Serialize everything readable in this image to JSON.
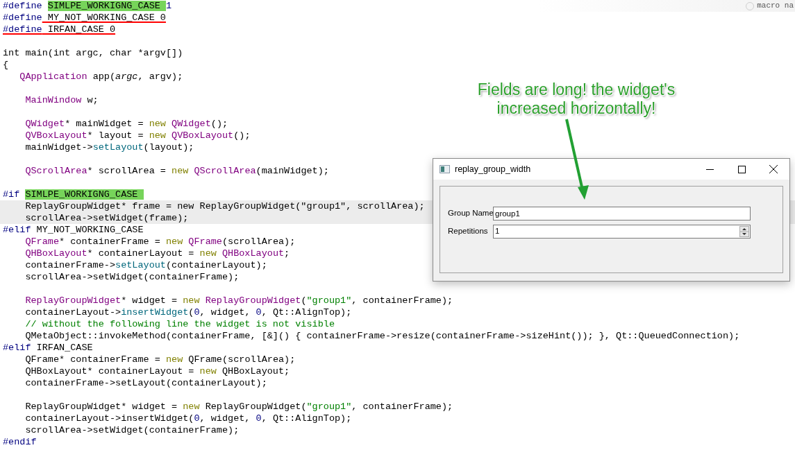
{
  "editor": {
    "lines": [
      {
        "current": false,
        "hint": "macro na",
        "segments": [
          {
            "text": "#define ",
            "kind": "directive"
          },
          {
            "text": "SIMLPE_WORKIGNG_CASE ",
            "kind": "highlight"
          },
          {
            "text": "1",
            "kind": "number"
          }
        ]
      },
      {
        "current": false,
        "segments": [
          {
            "text": "#define",
            "kind": "directive"
          },
          {
            "text": " MY_NOT_WORKING_CASE 0",
            "kind": "error"
          }
        ]
      },
      {
        "current": false,
        "segments": [
          {
            "text": "#define",
            "kind": "directive_error"
          },
          {
            "text": " IRFAN_CASE 0",
            "kind": "error"
          }
        ]
      },
      {
        "current": false
      },
      {
        "current": false,
        "segments": [
          {
            "text": "int main(int argc, char *argv[])",
            "kind": "plain"
          }
        ]
      },
      {
        "current": false,
        "segments": [
          {
            "text": "{",
            "kind": "plain"
          }
        ]
      },
      {
        "current": false,
        "segments": [
          {
            "text": "   QApplication",
            "kind": "type"
          },
          {
            "text": " app(",
            "kind": "plain"
          },
          {
            "text": "argc",
            "kind": "italic"
          },
          {
            "text": ", argv);",
            "kind": "plain"
          }
        ]
      },
      {
        "current": false
      },
      {
        "current": false,
        "segments": [
          {
            "text": "    MainWindow",
            "kind": "type"
          },
          {
            "text": " w;",
            "kind": "plain"
          }
        ]
      },
      {
        "current": false
      },
      {
        "current": false,
        "segments": [
          {
            "text": "    QWidget",
            "kind": "type"
          },
          {
            "text": "* mainWidget = ",
            "kind": "plain"
          },
          {
            "text": "new ",
            "kind": "keyword"
          },
          {
            "text": "QWidget",
            "kind": "type"
          },
          {
            "text": "();",
            "kind": "plain"
          }
        ]
      },
      {
        "current": false,
        "segments": [
          {
            "text": "    QVBoxLayout",
            "kind": "type"
          },
          {
            "text": "* layout = ",
            "kind": "plain"
          },
          {
            "text": "new ",
            "kind": "keyword"
          },
          {
            "text": "QVBoxLayout",
            "kind": "type"
          },
          {
            "text": "();",
            "kind": "plain"
          }
        ]
      },
      {
        "current": false,
        "segments": [
          {
            "text": "    mainWidget->",
            "kind": "plain"
          },
          {
            "text": "setLayout",
            "kind": "function"
          },
          {
            "text": "(layout);",
            "kind": "plain"
          }
        ]
      },
      {
        "current": false
      },
      {
        "current": false,
        "segments": [
          {
            "text": "    QScrollArea",
            "kind": "type"
          },
          {
            "text": "* scrollArea = ",
            "kind": "plain"
          },
          {
            "text": "new ",
            "kind": "keyword"
          },
          {
            "text": "QScrollArea",
            "kind": "type"
          },
          {
            "text": "(mainWidget);",
            "kind": "plain"
          }
        ]
      },
      {
        "current": false
      },
      {
        "current": false,
        "segments": [
          {
            "text": "#if ",
            "kind": "directive"
          },
          {
            "text": "SIMLPE_WORKIGNG_CASE ",
            "kind": "highlight"
          }
        ]
      },
      {
        "current": true,
        "segments": [
          {
            "text": "    ReplayGroupWidget* frame = new ReplayGroupWidget(\"group1\", scrollArea);",
            "kind": "plain"
          }
        ]
      },
      {
        "current": true,
        "segments": [
          {
            "text": "    scrollArea->setWidget(frame);",
            "kind": "plain"
          }
        ]
      },
      {
        "current": false,
        "segments": [
          {
            "text": "#elif",
            "kind": "directive"
          },
          {
            "text": " MY_NOT_WORKING_CASE",
            "kind": "plain"
          }
        ]
      },
      {
        "current": false,
        "segments": [
          {
            "text": "    QFrame",
            "kind": "type"
          },
          {
            "text": "* containerFrame = ",
            "kind": "plain"
          },
          {
            "text": "new ",
            "kind": "keyword"
          },
          {
            "text": "QFrame",
            "kind": "type"
          },
          {
            "text": "(scrollArea);",
            "kind": "plain"
          }
        ]
      },
      {
        "current": false,
        "segments": [
          {
            "text": "    QHBoxLayout",
            "kind": "type"
          },
          {
            "text": "* containerLayout = ",
            "kind": "plain"
          },
          {
            "text": "new ",
            "kind": "keyword"
          },
          {
            "text": "QHBoxLayout",
            "kind": "type"
          },
          {
            "text": ";",
            "kind": "plain"
          }
        ]
      },
      {
        "current": false,
        "segments": [
          {
            "text": "    containerFrame->",
            "kind": "plain"
          },
          {
            "text": "setLayout",
            "kind": "function"
          },
          {
            "text": "(containerLayout);",
            "kind": "plain"
          }
        ]
      },
      {
        "current": false,
        "segments": [
          {
            "text": "    scrollArea->setWidget(containerFrame);",
            "kind": "plain"
          }
        ]
      },
      {
        "current": false
      },
      {
        "current": false,
        "segments": [
          {
            "text": "    ReplayGroupWidget",
            "kind": "type"
          },
          {
            "text": "* widget = ",
            "kind": "plain"
          },
          {
            "text": "new ",
            "kind": "keyword"
          },
          {
            "text": "ReplayGroupWidget",
            "kind": "type"
          },
          {
            "text": "(",
            "kind": "plain"
          },
          {
            "text": "\"group1\"",
            "kind": "string"
          },
          {
            "text": ", containerFrame);",
            "kind": "plain"
          }
        ]
      },
      {
        "current": false,
        "segments": [
          {
            "text": "    containerLayout->",
            "kind": "plain"
          },
          {
            "text": "insertWidget",
            "kind": "function"
          },
          {
            "text": "(",
            "kind": "plain"
          },
          {
            "text": "0",
            "kind": "number"
          },
          {
            "text": ", widget, ",
            "kind": "plain"
          },
          {
            "text": "0",
            "kind": "number"
          },
          {
            "text": ", Qt::AlignTop);",
            "kind": "plain"
          }
        ]
      },
      {
        "current": false,
        "segments": [
          {
            "text": "    // without the following line the widget is not visible",
            "kind": "comment"
          }
        ]
      },
      {
        "current": false,
        "segments": [
          {
            "text": "    QMetaObject::invokeMethod(containerFrame, [&]() { containerFrame->resize(containerFrame->sizeHint()); }, Qt::QueuedConnection);",
            "kind": "plain"
          }
        ]
      },
      {
        "current": false,
        "segments": [
          {
            "text": "#elif",
            "kind": "directive"
          },
          {
            "text": " IRFAN_CASE",
            "kind": "plain"
          }
        ]
      },
      {
        "current": false,
        "segments": [
          {
            "text": "    QFrame* containerFrame = ",
            "kind": "plain"
          },
          {
            "text": "new",
            "kind": "keyword"
          },
          {
            "text": " QFrame(scrollArea);",
            "kind": "plain"
          }
        ]
      },
      {
        "current": false,
        "segments": [
          {
            "text": "    QHBoxLayout* containerLayout = ",
            "kind": "plain"
          },
          {
            "text": "new",
            "kind": "keyword"
          },
          {
            "text": " QHBoxLayout;",
            "kind": "plain"
          }
        ]
      },
      {
        "current": false,
        "segments": [
          {
            "text": "    containerFrame->setLayout(containerLayout);",
            "kind": "plain"
          }
        ]
      },
      {
        "current": false
      },
      {
        "current": false,
        "segments": [
          {
            "text": "    ReplayGroupWidget* widget = ",
            "kind": "plain"
          },
          {
            "text": "new",
            "kind": "keyword"
          },
          {
            "text": " ReplayGroupWidget(",
            "kind": "plain"
          },
          {
            "text": "\"group1\"",
            "kind": "string"
          },
          {
            "text": ", containerFrame);",
            "kind": "plain"
          }
        ]
      },
      {
        "current": false,
        "segments": [
          {
            "text": "    containerLayout->insertWidget(",
            "kind": "plain"
          },
          {
            "text": "0",
            "kind": "number"
          },
          {
            "text": ", widget, ",
            "kind": "plain"
          },
          {
            "text": "0",
            "kind": "number"
          },
          {
            "text": ", Qt::AlignTop);",
            "kind": "plain"
          }
        ]
      },
      {
        "current": false,
        "segments": [
          {
            "text": "    scrollArea->setWidget(containerFrame);",
            "kind": "plain"
          }
        ]
      },
      {
        "current": false,
        "segments": [
          {
            "text": "#endif",
            "kind": "directive"
          }
        ]
      }
    ]
  },
  "annotation": {
    "lines": [
      "Fields are long! the widget's",
      "increased horizontally!"
    ]
  },
  "dialog": {
    "title": "replay_group_width",
    "fields": [
      {
        "kind": "text",
        "label": "Group Name",
        "value": "group1"
      },
      {
        "kind": "spin",
        "label": "Repetitions",
        "value": "1"
      }
    ]
  }
}
